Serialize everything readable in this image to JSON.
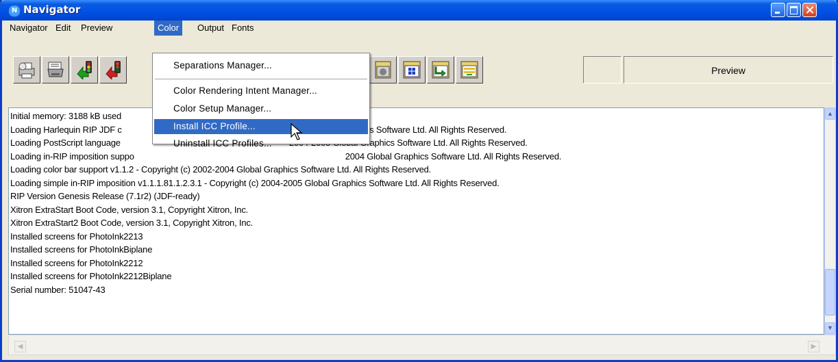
{
  "window": {
    "title": "Navigator",
    "app_icon_letter": "N"
  },
  "menubar": [
    "Navigator",
    "Edit",
    "Preview",
    "Color",
    "Output",
    "Fonts"
  ],
  "active_menu": "Color",
  "color_menu": {
    "items": [
      "Separations Manager...",
      "Color Rendering Intent Manager...",
      "Color Setup Manager...",
      "Install ICC Profile...",
      "Uninstall ICC Profiles..."
    ],
    "highlighted": "Install ICC Profile..."
  },
  "toolbar": {
    "buttons": [
      "print-icon",
      "printer-icon",
      "traffic-light-green-icon",
      "traffic-light-red-icon",
      "page-setup-icon",
      "blue-window-icon",
      "green-arrow-icon",
      "yellow-document-icon"
    ],
    "preview_label": "Preview"
  },
  "log_lines": [
    "Initial memory: 3188 kB used",
    "Loading Harlequin RIP JDF c",
    "2004 Global Graphics Software Ltd. All Rights Reserved.",
    "Loading PostScript language",
    "2004-2005 Global Graphics Software Ltd. All Rights Reserved.",
    "Loading in-RIP imposition suppo",
    "2004 Global Graphics Software Ltd. All Rights Reserved.",
    "Loading color bar support v1.1.2 - Copyright (c) 2002-2004 Global Graphics Software Ltd. All Rights Reserved.",
    "Loading simple in-RIP imposition v1.1.1.81.1.2.3.1 - Copyright (c) 2004-2005 Global Graphics Software Ltd. All Rights Reserved.",
    "RIP Version Genesis Release (7.1r2) (JDF-ready)",
    "Xitron ExtraStart Boot Code, version 3.1, Copyright Xitron, Inc.",
    "Xitron ExtraStart2 Boot Code, version 3.1, Copyright Xitron, Inc.",
    "Installed screens for PhotoInk2213",
    "Installed screens for PhotoInkBiplane",
    "Installed screens for PhotoInk2212",
    "Installed screens for PhotoInk2212Biplane",
    "Serial number: 51047-43"
  ]
}
